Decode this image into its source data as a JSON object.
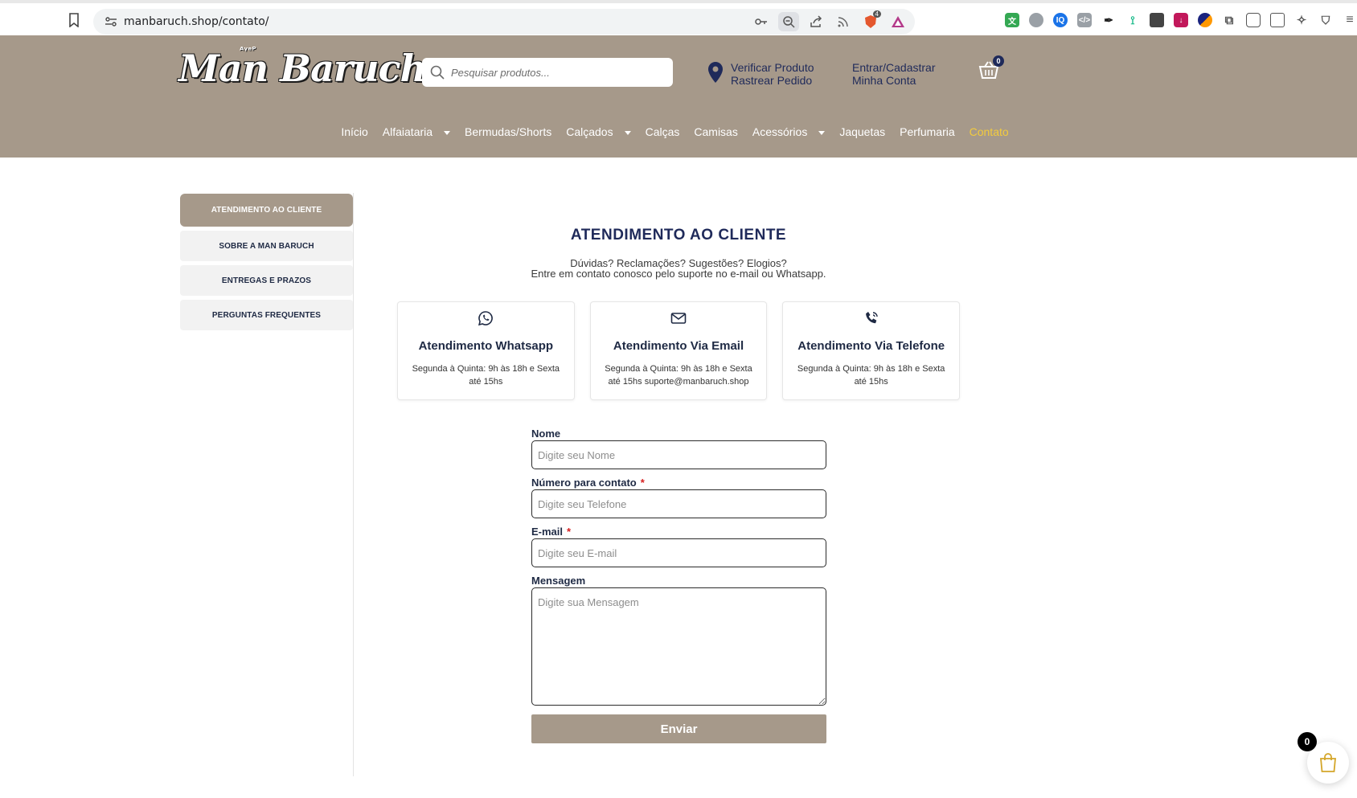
{
  "browser": {
    "url": "manbaruch.shop/contato/",
    "shield_count": "4"
  },
  "header": {
    "logo_text": "Man Baruch",
    "logo_mark": "ᴬᵞᵉᴾ",
    "search_placeholder": "Pesquisar produtos...",
    "verify_product": "Verificar Produto",
    "track_order": "Rastrear Pedido",
    "login_register": "Entrar/Cadastrar",
    "my_account": "Minha Conta",
    "cart_count": "0"
  },
  "nav": {
    "items": [
      {
        "label": "Início",
        "dropdown": false
      },
      {
        "label": "Alfaiataria",
        "dropdown": true
      },
      {
        "label": "Bermudas/Shorts",
        "dropdown": false
      },
      {
        "label": "Calçados",
        "dropdown": true
      },
      {
        "label": "Calças",
        "dropdown": false
      },
      {
        "label": "Camisas",
        "dropdown": false
      },
      {
        "label": "Acessórios",
        "dropdown": true
      },
      {
        "label": "Jaquetas",
        "dropdown": false
      },
      {
        "label": "Perfumaria",
        "dropdown": false
      },
      {
        "label": "Contato",
        "dropdown": false,
        "active": true
      }
    ]
  },
  "sidebar": {
    "items": [
      {
        "label": "ATENDIMENTO AO CLIENTE",
        "active": true
      },
      {
        "label": "SOBRE A MAN BARUCH"
      },
      {
        "label": "ENTREGAS E PRAZOS"
      },
      {
        "label": "PERGUNTAS FREQUENTES"
      }
    ]
  },
  "main": {
    "title": "ATENDIMENTO AO CLIENTE",
    "subtitle_line1": "Dúvidas? Reclamações? Sugestões? Elogios?",
    "subtitle_line2": "Entre em contato conosco pelo suporte no e-mail ou Whatsapp.",
    "cards": [
      {
        "icon": "whatsapp-icon",
        "title": "Atendimento Whatsapp",
        "text": "Segunda à Quinta: 9h às 18h e Sexta até 15hs"
      },
      {
        "icon": "email-icon",
        "title": "Atendimento Via Email",
        "text": "Segunda à Quinta: 9h às 18h e Sexta até 15hs suporte@manbaruch.shop"
      },
      {
        "icon": "phone-icon",
        "title": "Atendimento Via Telefone",
        "text": "Segunda à Quinta: 9h às 18h e Sexta até 15hs"
      }
    ]
  },
  "form": {
    "name_label": "Nome",
    "name_placeholder": "Digite seu Nome",
    "phone_label": "Número para contato",
    "phone_placeholder": "Digite seu Telefone",
    "email_label": "E-mail",
    "email_placeholder": "Digite seu E-mail",
    "message_label": "Mensagem",
    "message_placeholder": "Digite sua Mensagem",
    "required_mark": "*",
    "submit_label": "Enviar"
  },
  "floating_cart": {
    "count": "0"
  },
  "colors": {
    "brand": "#a6998a",
    "navy": "#1f2a5a",
    "active_nav": "#f3cb3d",
    "required": "#d61f1f"
  }
}
